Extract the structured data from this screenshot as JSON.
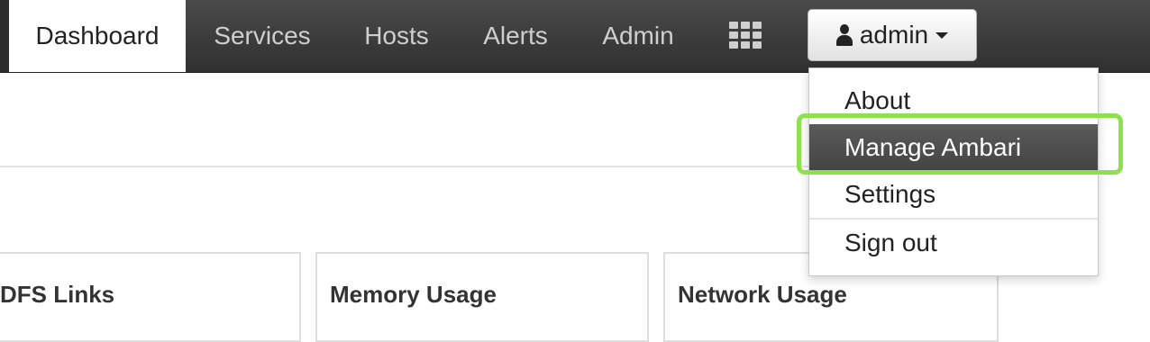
{
  "nav": {
    "items": [
      {
        "label": "Dashboard",
        "active": true
      },
      {
        "label": "Services",
        "active": false
      },
      {
        "label": "Hosts",
        "active": false
      },
      {
        "label": "Alerts",
        "active": false
      },
      {
        "label": "Admin",
        "active": false
      }
    ],
    "apps_icon": "grid-icon",
    "user": {
      "icon": "user-icon",
      "label": "admin",
      "caret": "caret-down-icon"
    }
  },
  "user_menu": {
    "items": [
      {
        "label": "About"
      },
      {
        "label": "Manage Ambari",
        "highlighted": true
      },
      {
        "label": "Settings"
      },
      {
        "label": "Sign out"
      }
    ]
  },
  "widgets": [
    {
      "title": "DFS Links"
    },
    {
      "title": "Memory Usage"
    },
    {
      "title": "Network Usage"
    }
  ],
  "colors": {
    "navbar": "#3c3c3c",
    "nav_text": "#cfcfcf",
    "menu_hover": "#4f4f4f",
    "annotation": "#8fe04e"
  }
}
